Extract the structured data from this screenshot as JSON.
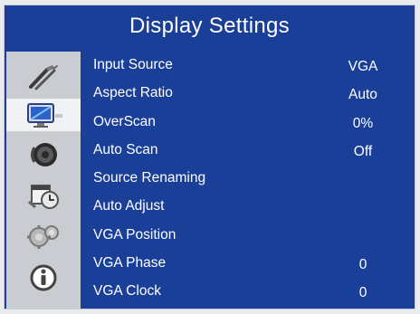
{
  "title": "Display Settings",
  "menu": [
    {
      "label": "Input Source",
      "value": "VGA"
    },
    {
      "label": "Aspect Ratio",
      "value": "Auto"
    },
    {
      "label": "OverScan",
      "value": "0%"
    },
    {
      "label": "Auto Scan",
      "value": "Off"
    },
    {
      "label": "Source Renaming",
      "value": ""
    },
    {
      "label": "Auto Adjust",
      "value": ""
    },
    {
      "label": "VGA Position",
      "value": ""
    },
    {
      "label": "VGA Phase",
      "value": "0"
    },
    {
      "label": "VGA Clock",
      "value": "0"
    }
  ],
  "colors": {
    "panel": "#1a3f99",
    "icon_column": "#c9ccd1",
    "selected_icon_bg": "#f1f2f4",
    "text": "#ffffff"
  },
  "icons": [
    {
      "name": "tools-icon",
      "selected": false
    },
    {
      "name": "display-monitor-icon",
      "selected": true
    },
    {
      "name": "speaker-audio-icon",
      "selected": false
    },
    {
      "name": "calendar-clock-icon",
      "selected": false
    },
    {
      "name": "gears-icon",
      "selected": false
    },
    {
      "name": "info-icon",
      "selected": false
    }
  ]
}
